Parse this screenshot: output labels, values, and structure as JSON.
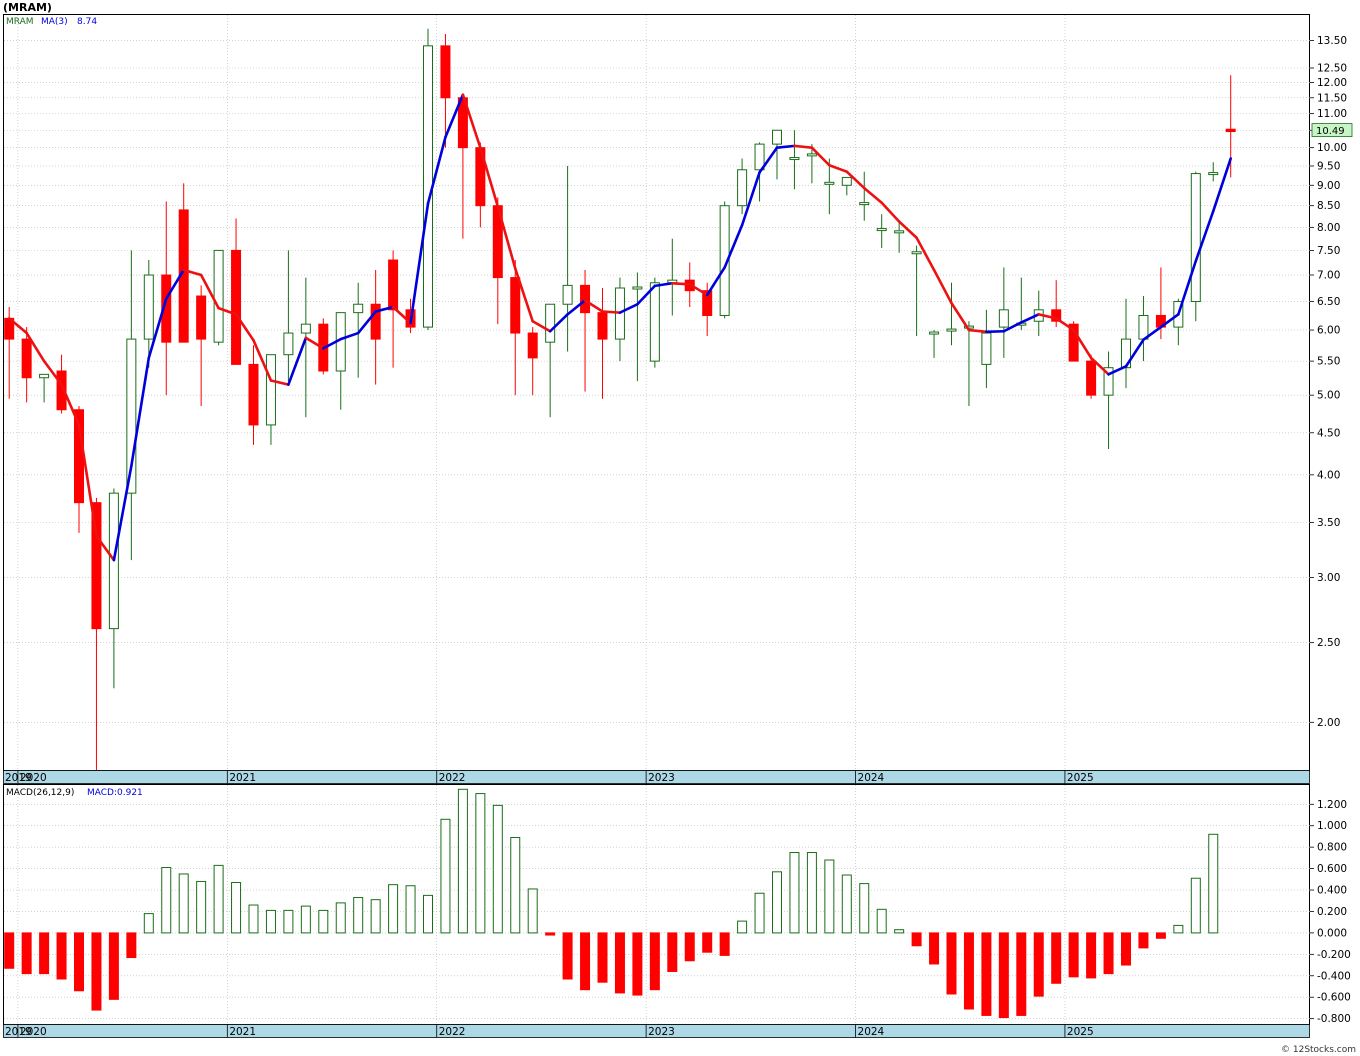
{
  "title": "(MRAM)",
  "watermark": "© 12Stocks.com",
  "price_panel": {
    "symbol": "MRAM",
    "ma_label": "MA(3)",
    "ma_value": "8.74",
    "last_price_label": "10.49",
    "y_ticks": [
      "2.00",
      "2.50",
      "3.00",
      "3.50",
      "4.00",
      "4.50",
      "5.00",
      "5.50",
      "6.00",
      "6.50",
      "7.00",
      "7.50",
      "8.00",
      "8.50",
      "9.00",
      "9.50",
      "10.00",
      "10.50",
      "11.00",
      "11.50",
      "12.00",
      "12.50",
      "13.50"
    ],
    "x_year_labels": [
      "2019",
      "2020",
      "2021",
      "2022",
      "2023",
      "2024",
      "2025"
    ]
  },
  "macd_panel": {
    "label": "MACD(26,12,9)",
    "value_label": "MACD:0.921",
    "y_ticks": [
      "1.200",
      "1.000",
      "0.800",
      "0.600",
      "0.400",
      "0.200",
      "0.000",
      "-0.200",
      "-0.400",
      "-0.600",
      "-0.800"
    ],
    "x_year_labels": [
      "2019",
      "2020",
      "2021",
      "2022",
      "2023",
      "2024",
      "2025"
    ]
  },
  "colors": {
    "up": "#1a6e1a",
    "down": "#ff0000",
    "ma_rising": "#0000dd",
    "ma_falling": "#ee1111",
    "axis_band": "#add8e6",
    "grid": "#b8b8b8",
    "last_price_bg": "#c8f5c8"
  },
  "chart_data": [
    {
      "type": "candlestick",
      "title": "",
      "y_scale": "log",
      "ylim": [
        1.75,
        14.5
      ],
      "x": [
        "2019-12",
        "2020-01",
        "2020-02",
        "2020-03",
        "2020-04",
        "2020-05",
        "2020-06",
        "2020-07",
        "2020-08",
        "2020-09",
        "2020-10",
        "2020-11",
        "2020-12",
        "2021-01",
        "2021-02",
        "2021-03",
        "2021-04",
        "2021-05",
        "2021-06",
        "2021-07",
        "2021-08",
        "2021-09",
        "2021-10",
        "2021-11",
        "2021-12",
        "2022-01",
        "2022-02",
        "2022-03",
        "2022-04",
        "2022-05",
        "2022-06",
        "2022-07",
        "2022-08",
        "2022-09",
        "2022-10",
        "2022-11",
        "2022-12",
        "2023-01",
        "2023-02",
        "2023-03",
        "2023-04",
        "2023-05",
        "2023-06",
        "2023-07",
        "2023-08",
        "2023-09",
        "2023-10",
        "2023-11",
        "2023-12",
        "2024-01",
        "2024-02",
        "2024-03",
        "2024-04",
        "2024-05",
        "2024-06",
        "2024-07",
        "2024-08",
        "2024-09",
        "2024-10",
        "2024-11",
        "2024-12",
        "2025-01",
        "2025-02",
        "2025-03",
        "2025-04",
        "2025-05",
        "2025-06",
        "2025-07",
        "2025-08",
        "2025-09",
        "2025-10",
        "2025-11"
      ],
      "open": [
        6.2,
        5.85,
        5.25,
        5.35,
        4.8,
        3.7,
        2.6,
        3.8,
        5.85,
        7.0,
        8.4,
        6.6,
        5.8,
        7.5,
        5.45,
        4.6,
        5.6,
        5.95,
        6.1,
        5.35,
        6.3,
        6.45,
        7.3,
        6.35,
        6.05,
        13.3,
        11.5,
        10.0,
        8.5,
        6.95,
        5.95,
        5.8,
        6.45,
        6.8,
        6.3,
        5.85,
        6.75,
        5.5,
        6.85,
        6.9,
        6.7,
        6.25,
        8.5,
        9.4,
        10.1,
        9.7,
        9.8,
        9.05,
        9.0,
        8.55,
        7.95,
        7.9,
        7.45,
        5.95,
        6.0,
        6.05,
        5.45,
        6.05,
        6.1,
        6.15,
        6.35,
        6.1,
        5.5,
        5.0,
        5.4,
        5.85,
        6.25,
        6.05,
        6.5,
        9.3,
        10.5
      ],
      "high": [
        6.4,
        6.05,
        5.3,
        5.6,
        4.85,
        3.75,
        3.85,
        7.5,
        7.3,
        8.6,
        9.05,
        6.8,
        7.1,
        8.2,
        5.75,
        4.75,
        7.5,
        6.95,
        6.2,
        6.25,
        6.85,
        7.1,
        7.5,
        6.55,
        13.95,
        13.75,
        11.55,
        10.15,
        8.7,
        7.3,
        6.05,
        6.25,
        9.5,
        7.1,
        6.75,
        6.95,
        7.05,
        6.95,
        7.75,
        7.25,
        6.85,
        8.6,
        9.7,
        10.15,
        10.5,
        10.5,
        10.1,
        9.7,
        9.1,
        9.35,
        8.3,
        8.1,
        7.6,
        6.0,
        6.85,
        6.15,
        6.35,
        7.15,
        6.95,
        6.7,
        6.9,
        6.15,
        5.6,
        5.65,
        6.55,
        6.6,
        7.15,
        6.55,
        9.35,
        9.6,
        12.25
      ],
      "low": [
        4.95,
        4.9,
        4.9,
        4.75,
        3.4,
        1.75,
        2.2,
        3.15,
        5.4,
        5.0,
        6.35,
        4.85,
        5.75,
        5.8,
        4.35,
        4.35,
        5.2,
        4.7,
        5.3,
        4.8,
        5.25,
        5.15,
        5.4,
        5.95,
        6.0,
        10.0,
        7.75,
        8.0,
        6.1,
        5.0,
        5.0,
        4.7,
        5.65,
        5.05,
        4.95,
        5.5,
        5.2,
        5.4,
        6.25,
        6.4,
        5.9,
        6.2,
        8.3,
        8.6,
        9.15,
        8.9,
        9.05,
        8.3,
        8.75,
        8.15,
        7.55,
        7.45,
        5.9,
        5.55,
        5.75,
        4.85,
        5.1,
        5.55,
        6.0,
        5.9,
        6.05,
        5.5,
        4.95,
        4.3,
        5.1,
        5.5,
        5.85,
        5.75,
        6.15,
        9.1,
        9.2
      ],
      "close": [
        5.85,
        5.25,
        5.3,
        4.8,
        3.7,
        2.6,
        3.8,
        5.85,
        7.0,
        5.8,
        5.8,
        5.85,
        7.5,
        5.45,
        4.6,
        5.6,
        5.95,
        6.1,
        5.35,
        6.3,
        6.45,
        5.85,
        6.35,
        6.05,
        13.3,
        11.5,
        10.0,
        8.5,
        6.95,
        5.95,
        5.55,
        6.45,
        6.8,
        6.3,
        5.85,
        6.75,
        6.75,
        6.85,
        6.9,
        6.7,
        6.25,
        8.5,
        9.4,
        10.1,
        10.5,
        9.7,
        9.8,
        9.05,
        9.2,
        8.55,
        7.95,
        7.9,
        7.45,
        5.95,
        6.0,
        6.05,
        5.95,
        6.35,
        6.1,
        6.35,
        6.15,
        5.5,
        5.0,
        5.4,
        5.85,
        6.25,
        6.05,
        6.5,
        9.3,
        9.3,
        10.49
      ],
      "ma3": [
        6.2,
        5.95,
        5.5,
        5.15,
        4.6,
        3.37,
        3.15,
        4.1,
        5.55,
        6.55,
        7.1,
        7.0,
        6.38,
        6.27,
        5.83,
        5.21,
        5.15,
        5.87,
        5.7,
        5.85,
        5.95,
        6.32,
        6.4,
        6.12,
        8.55,
        10.3,
        11.6,
        10.0,
        8.48,
        7.13,
        6.15,
        5.98,
        6.27,
        6.52,
        6.32,
        6.3,
        6.45,
        6.79,
        6.84,
        6.82,
        6.62,
        7.15,
        8.05,
        9.33,
        10.0,
        10.05,
        10.0,
        9.52,
        9.35,
        8.93,
        8.57,
        8.13,
        7.77,
        7.1,
        6.47,
        6.0,
        5.97,
        5.98,
        6.13,
        6.27,
        6.2,
        6.0,
        5.55,
        5.3,
        5.42,
        5.84,
        6.05,
        6.27,
        7.28,
        8.37,
        9.7
      ],
      "ma_note": "The last MA point prints 8.74 in the legend."
    },
    {
      "type": "bar",
      "title": "",
      "series_label": "MACD(26,12,9)",
      "ylim": [
        -0.85,
        1.38
      ],
      "x": [
        "2019-12",
        "2020-01",
        "2020-02",
        "2020-03",
        "2020-04",
        "2020-05",
        "2020-06",
        "2020-07",
        "2020-08",
        "2020-09",
        "2020-10",
        "2020-11",
        "2020-12",
        "2021-01",
        "2021-02",
        "2021-03",
        "2021-04",
        "2021-05",
        "2021-06",
        "2021-07",
        "2021-08",
        "2021-09",
        "2021-10",
        "2021-11",
        "2021-12",
        "2022-01",
        "2022-02",
        "2022-03",
        "2022-04",
        "2022-05",
        "2022-06",
        "2022-07",
        "2022-08",
        "2022-09",
        "2022-10",
        "2022-11",
        "2022-12",
        "2023-01",
        "2023-02",
        "2023-03",
        "2023-04",
        "2023-05",
        "2023-06",
        "2023-07",
        "2023-08",
        "2023-09",
        "2023-10",
        "2023-11",
        "2023-12",
        "2024-01",
        "2024-02",
        "2024-03",
        "2024-04",
        "2024-05",
        "2024-06",
        "2024-07",
        "2024-08",
        "2024-09",
        "2024-10",
        "2024-11",
        "2024-12",
        "2025-01",
        "2025-02",
        "2025-03",
        "2025-04",
        "2025-05",
        "2025-06",
        "2025-07",
        "2025-08",
        "2025-09",
        "2025-10",
        "2025-11"
      ],
      "values": [
        -0.33,
        -0.38,
        -0.38,
        -0.43,
        -0.54,
        -0.72,
        -0.62,
        -0.23,
        0.18,
        0.61,
        0.55,
        0.48,
        0.63,
        0.47,
        0.26,
        0.21,
        0.21,
        0.25,
        0.21,
        0.28,
        0.33,
        0.31,
        0.45,
        0.44,
        0.35,
        1.06,
        1.34,
        1.3,
        1.19,
        0.89,
        0.41,
        -0.02,
        -0.43,
        -0.53,
        -0.46,
        -0.56,
        -0.58,
        -0.53,
        -0.36,
        -0.26,
        -0.18,
        -0.21,
        0.11,
        0.37,
        0.57,
        0.75,
        0.75,
        0.68,
        0.54,
        0.46,
        0.22,
        0.03,
        -0.12,
        -0.29,
        -0.57,
        -0.71,
        -0.77,
        -0.79,
        -0.77,
        -0.59,
        -0.47,
        -0.41,
        -0.42,
        -0.38,
        -0.3,
        -0.14,
        -0.05,
        0.07,
        0.51,
        0.92
      ]
    }
  ]
}
